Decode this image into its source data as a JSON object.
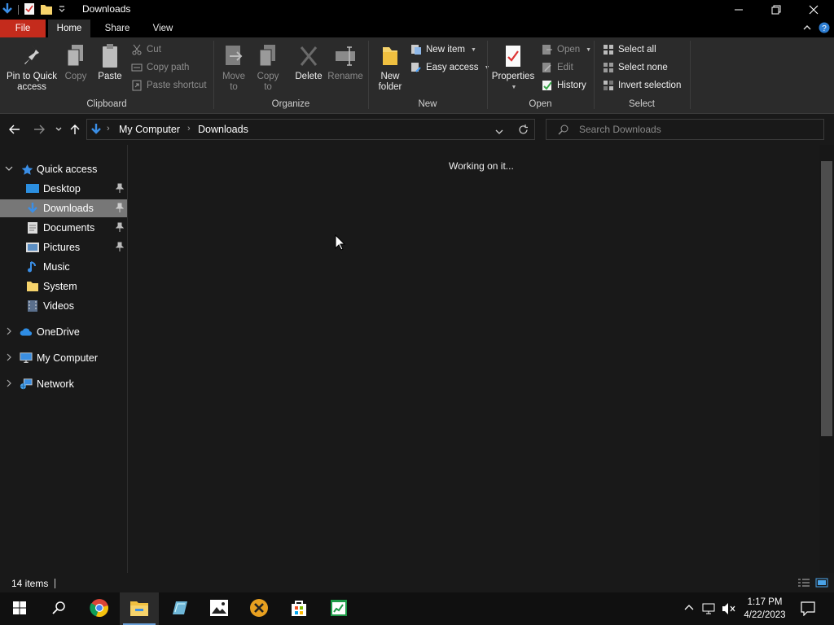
{
  "window": {
    "title": "Downloads",
    "controls": [
      "minimize",
      "restore",
      "close"
    ]
  },
  "ribbon_tabs": [
    {
      "label": "File"
    },
    {
      "label": "Home"
    },
    {
      "label": "Share"
    },
    {
      "label": "View"
    }
  ],
  "ribbon": {
    "clipboard": {
      "label": "Clipboard",
      "pin": "Pin to Quick\naccess",
      "pin_l1": "Pin to Quick",
      "pin_l2": "access",
      "copy": "Copy",
      "paste": "Paste",
      "cut": "Cut",
      "copy_path": "Copy path",
      "paste_shortcut": "Paste shortcut"
    },
    "organize": {
      "label": "Organize",
      "move_l1": "Move",
      "move_l2": "to",
      "copy_l1": "Copy",
      "copy_l2": "to",
      "delete": "Delete",
      "rename": "Rename"
    },
    "new": {
      "label": "New",
      "folder_l1": "New",
      "folder_l2": "folder",
      "new_item": "New item",
      "easy_access": "Easy access"
    },
    "open": {
      "label": "Open",
      "properties": "Properties",
      "open": "Open",
      "edit": "Edit",
      "history": "History"
    },
    "select": {
      "label": "Select",
      "select_all": "Select all",
      "select_none": "Select none",
      "invert": "Invert selection"
    }
  },
  "address": {
    "crumbs": [
      "My Computer",
      "Downloads"
    ],
    "search_placeholder": "Search Downloads"
  },
  "sidebar": {
    "quick_access": "Quick access",
    "items": [
      {
        "label": "Desktop",
        "icon": "desktop-icon",
        "pinned": true
      },
      {
        "label": "Downloads",
        "icon": "downloads-icon",
        "pinned": true,
        "selected": true
      },
      {
        "label": "Documents",
        "icon": "documents-icon",
        "pinned": true
      },
      {
        "label": "Pictures",
        "icon": "pictures-icon",
        "pinned": true
      },
      {
        "label": "Music",
        "icon": "music-icon",
        "pinned": false
      },
      {
        "label": "System",
        "icon": "folder-icon",
        "pinned": false
      },
      {
        "label": "Videos",
        "icon": "videos-icon",
        "pinned": false
      }
    ],
    "onedrive": "OneDrive",
    "my_computer": "My Computer",
    "network": "Network"
  },
  "content": {
    "status_message": "Working on it..."
  },
  "statusbar": {
    "item_count": "14 items"
  },
  "taskbar": {
    "apps": [
      "start-icon",
      "search-icon",
      "chrome-icon",
      "file-explorer-icon",
      "notepad-icon",
      "photos-icon",
      "xmind-icon",
      "store-icon",
      "sheets-icon"
    ],
    "time": "1:17 PM",
    "date": "4/22/2023"
  },
  "colors": {
    "file_tab": "#c42b1c",
    "selected_nav": "#777777",
    "ribbon_bg": "#2b2b2b",
    "window_bg": "#191919",
    "accent": "#1e90ff"
  }
}
